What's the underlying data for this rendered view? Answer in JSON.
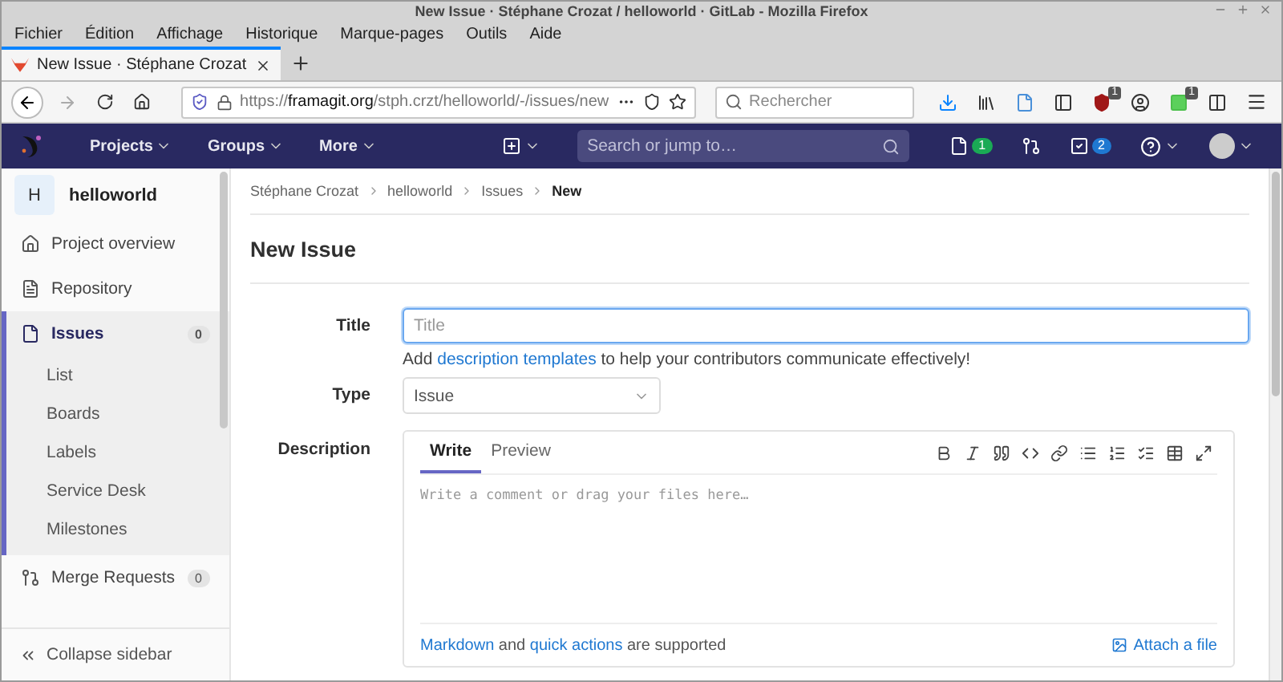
{
  "window": {
    "title": "New Issue · Stéphane Crozat / helloworld · GitLab - Mozilla Firefox"
  },
  "menu_bar": [
    "Fichier",
    "Édition",
    "Affichage",
    "Historique",
    "Marque-pages",
    "Outils",
    "Aide"
  ],
  "browser_tabs": [
    {
      "label": "New Issue · Stéphane Crozat",
      "selected": true
    }
  ],
  "address_bar": {
    "scheme": "https://",
    "host": "framagit.org",
    "path": "/stph.crzt/helloworld/-/issues/new"
  },
  "browser_search": {
    "placeholder": "Rechercher"
  },
  "shield_extension": {
    "badge": "1"
  },
  "grid_extension": {
    "badge": "1"
  },
  "gitlab_nav": {
    "links": [
      "Projects",
      "Groups",
      "More"
    ],
    "search": {
      "placeholder": "Search or jump to…"
    },
    "issues_count": "1",
    "todos_count": "2"
  },
  "sidebar": {
    "project": {
      "initial": "H",
      "name": "helloworld"
    },
    "items": [
      {
        "label": "Project overview",
        "kind": "overview",
        "selected": false
      },
      {
        "label": "Repository",
        "kind": "repository",
        "selected": false
      },
      {
        "label": "Issues",
        "kind": "issues",
        "selected": true,
        "count": "0",
        "children": [
          {
            "label": "List",
            "selected": false
          },
          {
            "label": "Boards",
            "selected": false
          },
          {
            "label": "Labels",
            "selected": false
          },
          {
            "label": "Service Desk",
            "selected": false
          },
          {
            "label": "Milestones",
            "selected": false
          }
        ]
      },
      {
        "label": "Merge Requests",
        "kind": "merge_requests",
        "selected": false,
        "count": "0"
      }
    ],
    "collapse": "Collapse sidebar"
  },
  "breadcrumbs": [
    {
      "label": "Stéphane Crozat",
      "current": false
    },
    {
      "label": "helloworld",
      "current": false
    },
    {
      "label": "Issues",
      "current": false
    },
    {
      "label": "New",
      "current": true
    }
  ],
  "page_title": "New Issue",
  "form": {
    "title": {
      "label": "Title",
      "placeholder": "Title",
      "help": [
        {
          "text": "Add ",
          "link": false
        },
        {
          "text": "description templates",
          "link": true
        },
        {
          "text": " to help your contributors communicate effectively!",
          "link": false
        }
      ]
    },
    "type": {
      "label": "Type",
      "value": "Issue"
    },
    "description": {
      "label": "Description",
      "tabs": [
        {
          "label": "Write",
          "selected": true
        },
        {
          "label": "Preview",
          "selected": false
        }
      ],
      "placeholder": "Write a comment or drag your files here…",
      "footer": [
        {
          "text": "Markdown",
          "link": true
        },
        {
          "text": " and ",
          "link": false
        },
        {
          "text": "quick actions",
          "link": true
        },
        {
          "text": " are supported",
          "link": false
        }
      ],
      "attach": "Attach a file"
    }
  }
}
